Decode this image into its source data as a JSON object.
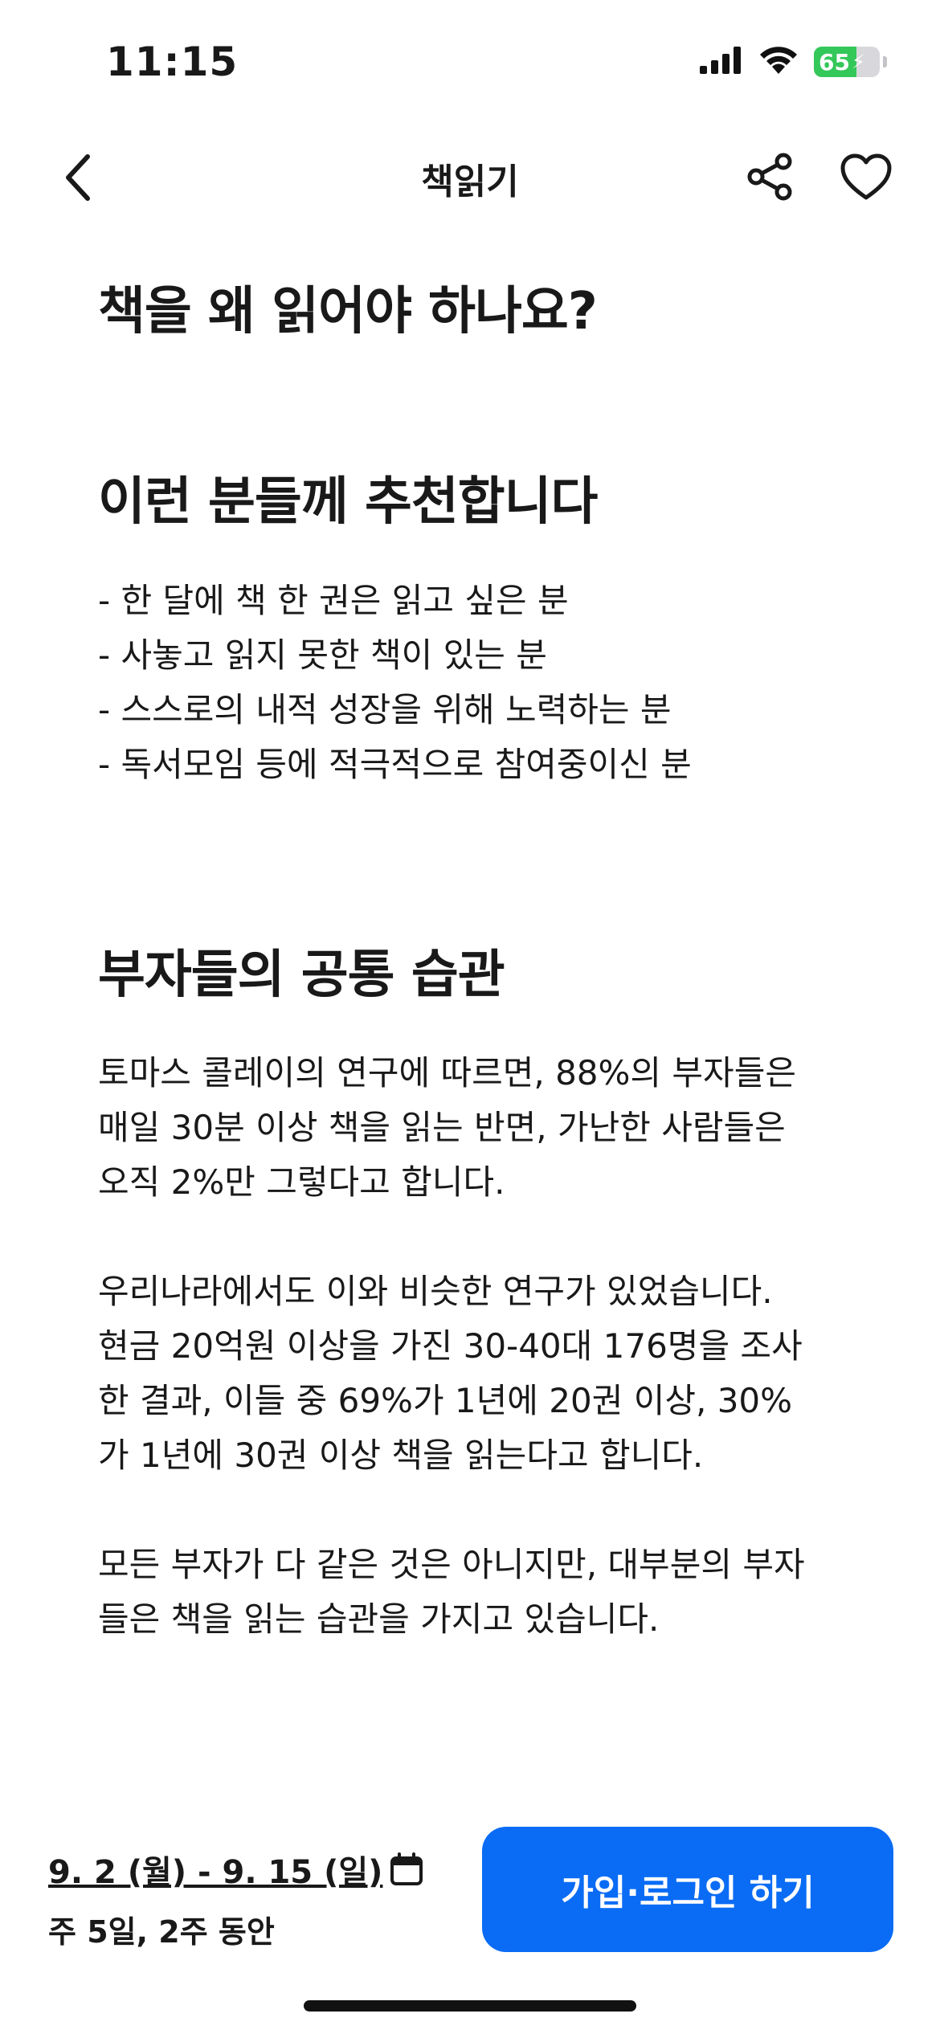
{
  "status_bar": {
    "time": "11:15",
    "battery_level": "65",
    "battery_fraction": 0.65,
    "battery_color": "#34c759",
    "icons": [
      "signal-icon",
      "wifi-icon",
      "battery-icon",
      "charging-bolt-icon"
    ]
  },
  "nav": {
    "title": "책읽기",
    "icons": [
      "back-chevron-icon",
      "share-icon",
      "heart-icon"
    ]
  },
  "content": {
    "section1_title": "책을 왜 읽어야 하나요?",
    "section2_title": "이런 분들께 추천합니다",
    "recommend_items": [
      "- 한 달에 책 한 권은 읽고 싶은 분",
      "- 사놓고 읽지 못한 책이 있는 분",
      "- 스스로의 내적 성장을 위해 노력하는 분",
      "- 독서모임 등에 적극적으로 참여중이신 분"
    ],
    "section3_title": "부자들의 공통 습관",
    "paragraphs": [
      "토마스 콜레이의 연구에 따르면, 88%의 부자들은\n매일 30분 이상 책을 읽는 반면, 가난한 사람들은\n오직 2%만 그렇다고 합니다.",
      "우리나라에서도 이와 비슷한 연구가 있었습니다.\n현금 20억원 이상을 가진 30-40대 176명을 조사\n한 결과, 이들 중 69%가 1년에 20권 이상, 30%\n가 1년에 30권 이상 책을 읽는다고 합니다.",
      "모든 부자가 다 같은 것은 아니지만, 대부분의 부자\n들은 책을 읽는 습관을 가지고 있습니다."
    ]
  },
  "bottom": {
    "date_range": "9. 2 (월) - 9. 15 (일)",
    "frequency": "주 5일, 2주 동안",
    "cta_label": "가입·로그인 하기",
    "cta_color": "#0a6cf5",
    "calendar_icon": "calendar-icon"
  }
}
